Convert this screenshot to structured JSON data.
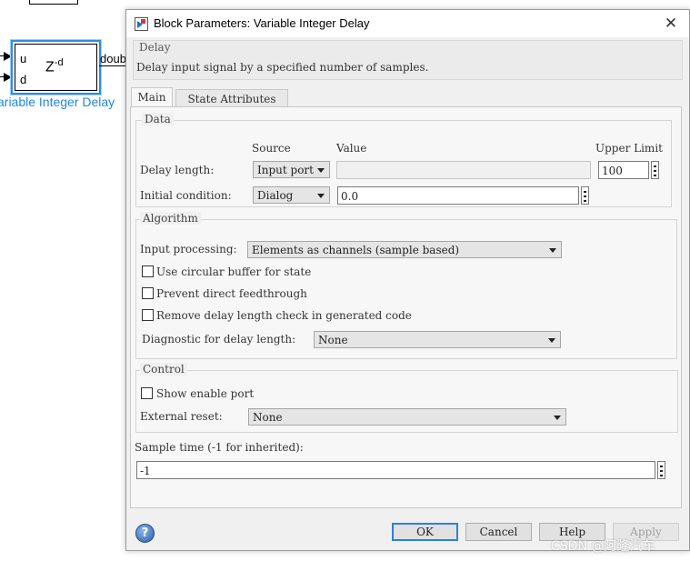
{
  "canvas": {
    "block_label": "Z",
    "block_label_sup": "-d",
    "port_u": "u",
    "port_d": "d",
    "output_label": "doub",
    "block_name": "ariable Integer Delay"
  },
  "dialog": {
    "title": "Block Parameters: Variable Integer Delay",
    "close_glyph": "✕",
    "description_group": "Delay",
    "description": "Delay input signal by a specified number of samples.",
    "tabs": [
      {
        "label": "Main",
        "active": true
      },
      {
        "label": "State Attributes",
        "active": false
      }
    ],
    "data_group": {
      "title": "Data",
      "col_source": "Source",
      "col_value": "Value",
      "col_upper": "Upper Limit",
      "rows": [
        {
          "label": "Delay length:",
          "source": "Input port",
          "value": "",
          "upper_limit": "100"
        },
        {
          "label": "Initial condition:",
          "source": "Dialog",
          "value": "0.0"
        }
      ]
    },
    "algorithm_group": {
      "title": "Algorithm",
      "input_processing_label": "Input processing:",
      "input_processing_value": "Elements as channels (sample based)",
      "checkboxes": [
        {
          "label": "Use circular buffer for state",
          "checked": false
        },
        {
          "label": "Prevent direct feedthrough",
          "checked": false
        },
        {
          "label": "Remove delay length check in generated code",
          "checked": false
        }
      ],
      "diagnostic_label": "Diagnostic for delay length:",
      "diagnostic_value": "None"
    },
    "control_group": {
      "title": "Control",
      "show_enable_label": "Show enable port",
      "show_enable_checked": false,
      "external_reset_label": "External reset:",
      "external_reset_value": "None"
    },
    "sample_time": {
      "label": "Sample time (-1 for inherited):",
      "value": "-1"
    },
    "buttons": {
      "help_icon": "?",
      "ok": "OK",
      "cancel": "Cancel",
      "help": "Help",
      "apply": "Apply"
    }
  },
  "watermark": "CSDN @阿隆汽车"
}
